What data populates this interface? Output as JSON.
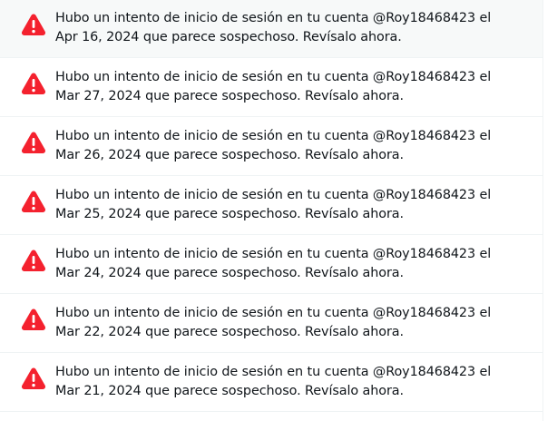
{
  "notifications": {
    "items": [
      {
        "icon": "warning-icon",
        "message": "Hubo un intento de inicio de sesión en tu cuenta @Roy18468423 el Apr 16, 2024 que parece sospechoso. Revísalo ahora."
      },
      {
        "icon": "warning-icon",
        "message": "Hubo un intento de inicio de sesión en tu cuenta @Roy18468423 el Mar 27, 2024 que parece sospechoso. Revísalo ahora."
      },
      {
        "icon": "warning-icon",
        "message": "Hubo un intento de inicio de sesión en tu cuenta @Roy18468423 el Mar 26, 2024 que parece sospechoso. Revísalo ahora."
      },
      {
        "icon": "warning-icon",
        "message": "Hubo un intento de inicio de sesión en tu cuenta @Roy18468423 el Mar 25, 2024 que parece sospechoso. Revísalo ahora."
      },
      {
        "icon": "warning-icon",
        "message": "Hubo un intento de inicio de sesión en tu cuenta @Roy18468423 el Mar 24, 2024 que parece sospechoso. Revísalo ahora."
      },
      {
        "icon": "warning-icon",
        "message": "Hubo un intento de inicio de sesión en tu cuenta @Roy18468423 el Mar 22, 2024 que parece sospechoso. Revísalo ahora."
      },
      {
        "icon": "warning-icon",
        "message": "Hubo un intento de inicio de sesión en tu cuenta @Roy18468423 el Mar 21, 2024 que parece sospechoso. Revísalo ahora."
      }
    ]
  },
  "colors": {
    "warning": "#f4212e",
    "text": "#0f1419",
    "divider": "#eff3f4"
  }
}
